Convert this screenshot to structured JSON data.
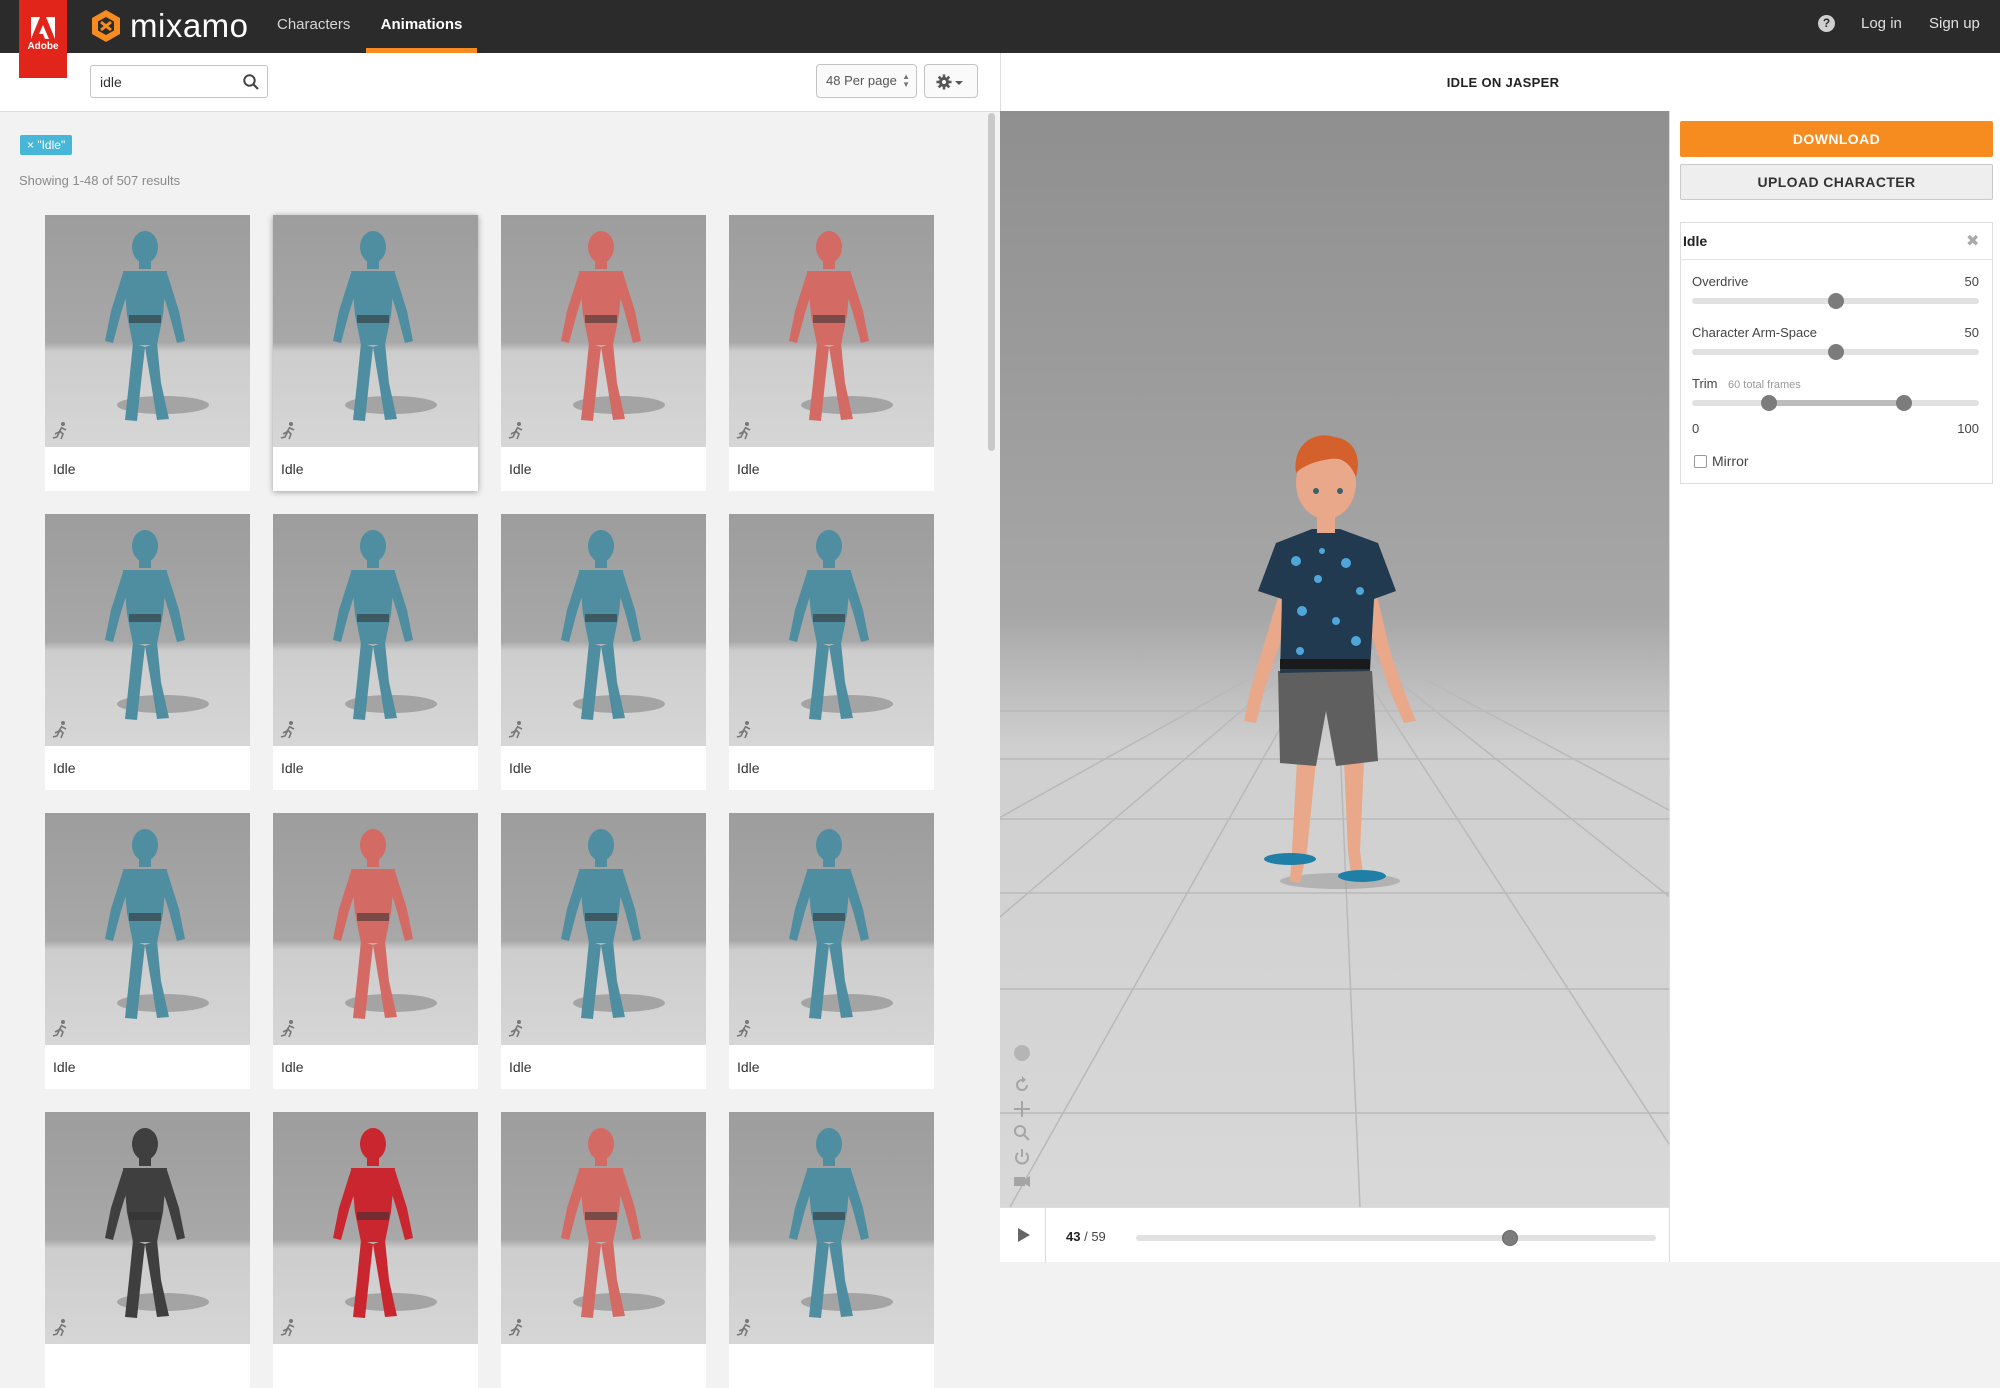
{
  "brand": {
    "adobe_text": "Adobe",
    "app_name": "mixamo"
  },
  "nav": {
    "tabs": [
      {
        "label": "Characters",
        "active": false
      },
      {
        "label": "Animations",
        "active": true
      }
    ],
    "login_label": "Log in",
    "signup_label": "Sign up",
    "help_icon": "?"
  },
  "search": {
    "value": "idle",
    "placeholder": ""
  },
  "toolbar": {
    "per_page_label": "48 Per page"
  },
  "filters": {
    "tag_label": "× \"Idle\"",
    "results_text": "Showing 1-48 of 507 results"
  },
  "cards": [
    {
      "label": "Idle",
      "color": "#4f8ea0",
      "selected": false
    },
    {
      "label": "Idle",
      "color": "#4f8ea0",
      "selected": true
    },
    {
      "label": "Idle",
      "color": "#d46a64",
      "selected": false
    },
    {
      "label": "Idle",
      "color": "#d46a64",
      "selected": false
    },
    {
      "label": "Idle",
      "color": "#4f8ea0",
      "selected": false
    },
    {
      "label": "Idle",
      "color": "#4f8ea0",
      "selected": false
    },
    {
      "label": "Idle",
      "color": "#4f8ea0",
      "selected": false
    },
    {
      "label": "Idle",
      "color": "#4f8ea0",
      "selected": false
    },
    {
      "label": "Idle",
      "color": "#4f8ea0",
      "selected": false
    },
    {
      "label": "Idle",
      "color": "#d46a64",
      "selected": false
    },
    {
      "label": "Idle",
      "color": "#4f8ea0",
      "selected": false
    },
    {
      "label": "Idle",
      "color": "#4f8ea0",
      "selected": false
    },
    {
      "label": "",
      "color": "#3f3f3f",
      "selected": false
    },
    {
      "label": "",
      "color": "#c9262f",
      "selected": false
    },
    {
      "label": "",
      "color": "#d46a64",
      "selected": false
    },
    {
      "label": "",
      "color": "#4f8ea0",
      "selected": false
    }
  ],
  "viewer": {
    "title": "IDLE ON JASPER",
    "current_frame": "43",
    "total_frames": "59",
    "timeline_progress": 0.72
  },
  "actions": {
    "download_label": "DOWNLOAD",
    "upload_label": "UPLOAD CHARACTER"
  },
  "settings": {
    "title": "Idle",
    "overdrive_label": "Overdrive",
    "overdrive_value": "50",
    "overdrive_fraction": 0.5,
    "arm_space_label": "Character Arm-Space",
    "arm_space_value": "50",
    "arm_space_fraction": 0.5,
    "trim_label": "Trim",
    "trim_frames_label": "60 total frames",
    "trim_start_label": "0",
    "trim_end_label": "100",
    "trim_start_fraction": 0.27,
    "trim_end_fraction": 0.74,
    "mirror_label": "Mirror",
    "mirror_checked": false
  },
  "colors": {
    "accent": "#f68b1f",
    "adobe_red": "#e1251b",
    "tag_blue": "#46b7d8",
    "topbar": "#2b2b2b"
  }
}
